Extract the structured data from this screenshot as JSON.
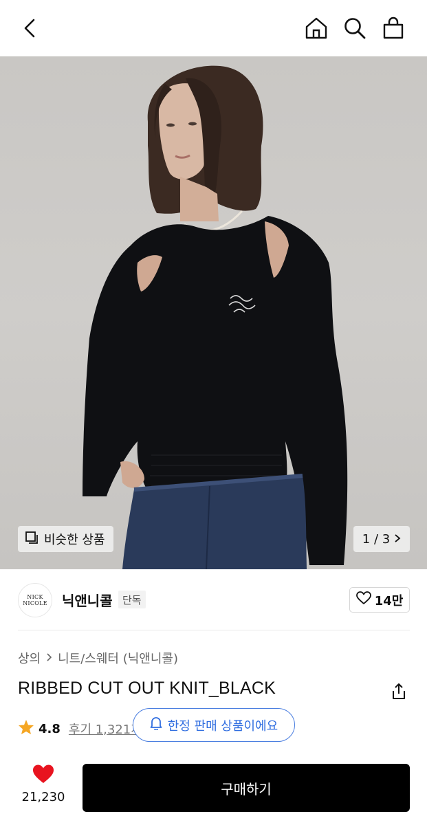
{
  "header": {
    "back_icon": "chevron-left-icon",
    "home_icon": "home-icon",
    "search_icon": "search-icon",
    "cart_icon": "shopping-bag-icon"
  },
  "gallery": {
    "similar_label": "비슷한 상품",
    "page_indicator": "1 / 3"
  },
  "brand": {
    "logo_line1": "NICK",
    "logo_line2": "NICOLE",
    "name": "닉앤니콜",
    "tag": "단독",
    "likes": "14만"
  },
  "breadcrumb": {
    "category": "상의",
    "subcategory": "니트/스웨터 (닉앤니콜)"
  },
  "product": {
    "title": "RIBBED CUT OUT KNIT_BLACK",
    "rating": "4.8",
    "reviews": "후기 1,321개",
    "limited_badge": "한정 판매 상품이에요"
  },
  "bottom": {
    "wish_count": "21,230",
    "buy_label": "구매하기"
  },
  "colors": {
    "accent_blue": "#2f6de0",
    "heart_red": "#e8131f",
    "star": "#f5a623",
    "buy_bg": "#000000"
  }
}
